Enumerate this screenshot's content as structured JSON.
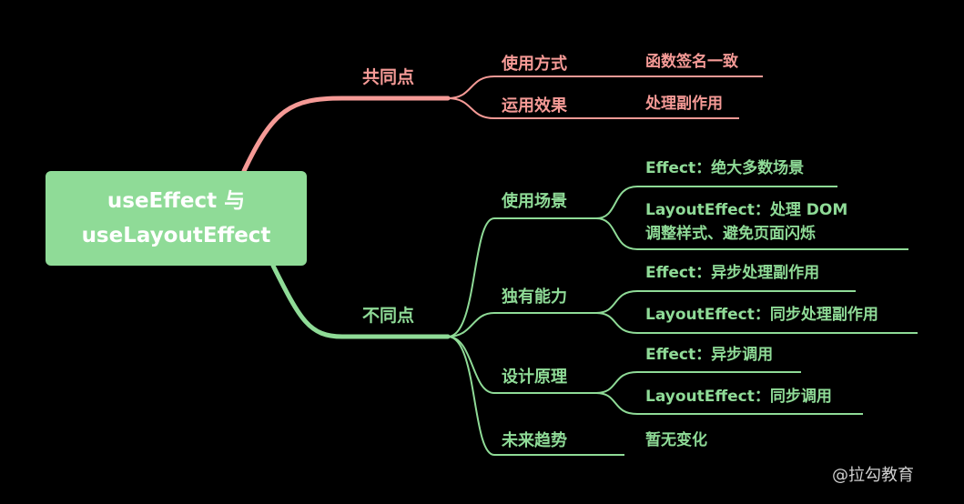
{
  "colors": {
    "background": "#000000",
    "pink": "#f59a96",
    "green": "#8fdb97",
    "root_fill": "#8fdb97"
  },
  "root": {
    "line1": "useEffect 与",
    "line2": "useLayoutEffect"
  },
  "similar": {
    "label": "共同点",
    "items": [
      {
        "label": "使用方式",
        "details": [
          "函数签名一致"
        ]
      },
      {
        "label": "运用效果",
        "details": [
          "处理副作用"
        ]
      }
    ]
  },
  "different": {
    "label": "不同点",
    "items": [
      {
        "label": "使用场景",
        "details": [
          "Effect：绝大多数场景",
          "LayoutEffect：处理 DOM",
          "调整样式、避免页面闪烁"
        ]
      },
      {
        "label": "独有能力",
        "details": [
          "Effect：异步处理副作用",
          "LayoutEffect：同步处理副作用"
        ]
      },
      {
        "label": "设计原理",
        "details": [
          "Effect：异步调用",
          "LayoutEffect：同步调用"
        ]
      },
      {
        "label": "未来趋势",
        "details": [
          "暂无变化"
        ]
      }
    ]
  },
  "watermark": "@拉勾教育"
}
